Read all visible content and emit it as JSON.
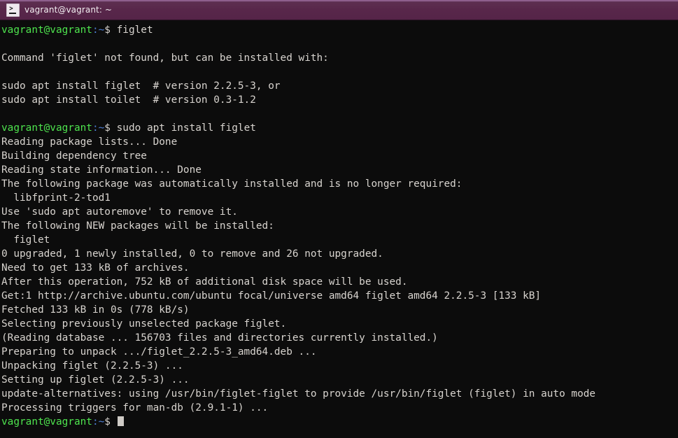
{
  "window": {
    "title": "vagrant@vagrant: ~",
    "icon": "terminal-prompt-icon",
    "titlebar_color": "#58274a",
    "background_color": "#0c0c0c",
    "foreground_color": "#d8d4cf"
  },
  "prompt": {
    "user_host": "vagrant@vagrant",
    "path": ":~",
    "symbol": "$",
    "user_host_color": "#4ee44e",
    "path_color": "#4f7fd6"
  },
  "terminal": {
    "lines": [
      {
        "type": "prompt",
        "command": " figlet"
      },
      {
        "type": "blank",
        "text": ""
      },
      {
        "type": "output",
        "text": "Command 'figlet' not found, but can be installed with:"
      },
      {
        "type": "blank",
        "text": ""
      },
      {
        "type": "output",
        "text": "sudo apt install figlet  # version 2.2.5-3, or"
      },
      {
        "type": "output",
        "text": "sudo apt install toilet  # version 0.3-1.2"
      },
      {
        "type": "blank",
        "text": ""
      },
      {
        "type": "prompt",
        "command": " sudo apt install figlet"
      },
      {
        "type": "output",
        "text": "Reading package lists... Done"
      },
      {
        "type": "output",
        "text": "Building dependency tree"
      },
      {
        "type": "output",
        "text": "Reading state information... Done"
      },
      {
        "type": "output",
        "text": "The following package was automatically installed and is no longer required:"
      },
      {
        "type": "output",
        "text": "  libfprint-2-tod1"
      },
      {
        "type": "output",
        "text": "Use 'sudo apt autoremove' to remove it."
      },
      {
        "type": "output",
        "text": "The following NEW packages will be installed:"
      },
      {
        "type": "output",
        "text": "  figlet"
      },
      {
        "type": "output",
        "text": "0 upgraded, 1 newly installed, 0 to remove and 26 not upgraded."
      },
      {
        "type": "output",
        "text": "Need to get 133 kB of archives."
      },
      {
        "type": "output",
        "text": "After this operation, 752 kB of additional disk space will be used."
      },
      {
        "type": "output",
        "text": "Get:1 http://archive.ubuntu.com/ubuntu focal/universe amd64 figlet amd64 2.2.5-3 [133 kB]"
      },
      {
        "type": "output",
        "text": "Fetched 133 kB in 0s (778 kB/s)"
      },
      {
        "type": "output",
        "text": "Selecting previously unselected package figlet."
      },
      {
        "type": "output",
        "text": "(Reading database ... 156703 files and directories currently installed.)"
      },
      {
        "type": "output",
        "text": "Preparing to unpack .../figlet_2.2.5-3_amd64.deb ..."
      },
      {
        "type": "output",
        "text": "Unpacking figlet (2.2.5-3) ..."
      },
      {
        "type": "output",
        "text": "Setting up figlet (2.2.5-3) ..."
      },
      {
        "type": "output",
        "text": "update-alternatives: using /usr/bin/figlet-figlet to provide /usr/bin/figlet (figlet) in auto mode"
      },
      {
        "type": "output",
        "text": "Processing triggers for man-db (2.9.1-1) ..."
      },
      {
        "type": "prompt",
        "command": "",
        "cursor": true
      }
    ]
  }
}
